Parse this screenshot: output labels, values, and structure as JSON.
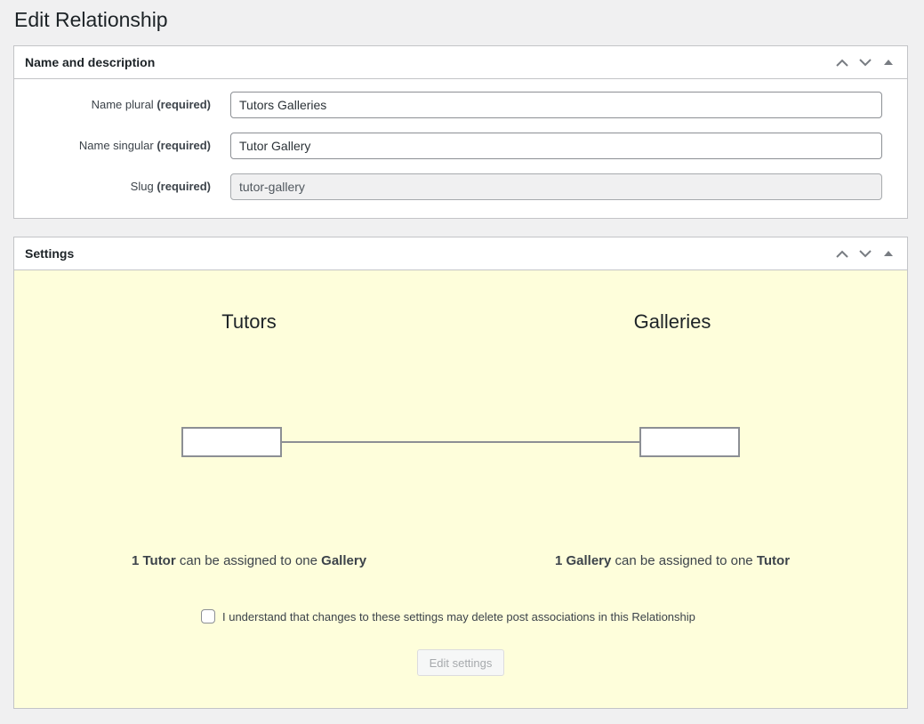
{
  "page": {
    "title": "Edit Relationship"
  },
  "name_box": {
    "title": "Name and description",
    "fields": [
      {
        "label": "Name plural",
        "required": "(required)",
        "value": "Tutors Galleries"
      },
      {
        "label": "Name singular",
        "required": "(required)",
        "value": "Tutor Gallery"
      },
      {
        "label": "Slug",
        "required": "(required)",
        "value": "tutor-gallery"
      }
    ]
  },
  "settings_box": {
    "title": "Settings",
    "left": {
      "title": "Tutors",
      "count": "1",
      "singular": "Tutor",
      "middle": "can be assigned to one",
      "target": "Gallery"
    },
    "right": {
      "title": "Galleries",
      "count": "1",
      "singular": "Gallery",
      "middle": "can be assigned to one",
      "target": "Tutor"
    },
    "confirm_text": "I understand that changes to these settings may delete post associations in this Relationship",
    "confirm_checked": false,
    "edit_button": "Edit settings"
  },
  "icons": {
    "move_up": "chevron-up-icon",
    "move_down": "chevron-down-icon",
    "toggle": "caret-up-icon"
  },
  "colors": {
    "settings_bg": "#fefedb",
    "page_bg": "#f0f0f1",
    "border": "#c3c4c7"
  }
}
